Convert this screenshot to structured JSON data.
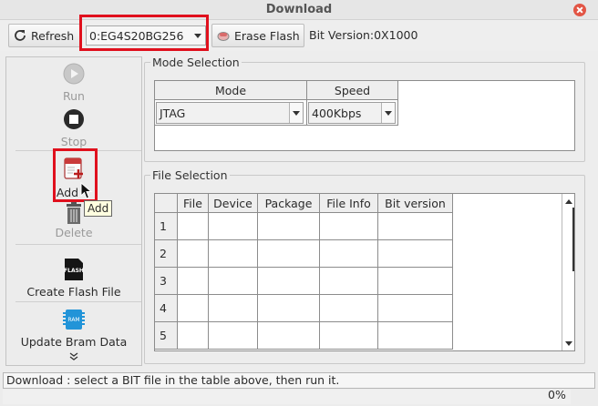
{
  "window": {
    "title": "Download"
  },
  "toolbar": {
    "refresh_label": "Refresh",
    "device_value": "0:EG4S20BG256",
    "erase_label": "Erase Flash",
    "bit_version": "Bit Version:0X1000"
  },
  "left": {
    "run_label": "Run",
    "stop_label": "Stop",
    "add_label": "Add",
    "delete_label": "Delete",
    "flash_icon_text": "FLASH",
    "create_flash_label": "Create Flash File",
    "ram_icon_text": "RAM",
    "update_bram_label": "Update Bram Data"
  },
  "mode_selection": {
    "title": "Mode Selection",
    "headers": [
      "Mode",
      "Speed"
    ],
    "mode_value": "JTAG",
    "speed_value": "400Kbps"
  },
  "file_selection": {
    "title": "File Selection",
    "headers": [
      "File",
      "Device",
      "Package",
      "File Info",
      "Bit version"
    ],
    "rows": [
      "1",
      "2",
      "3",
      "4",
      "5"
    ]
  },
  "tooltip": "Add",
  "status": {
    "message": "Download : select a BIT file in the table above, then run it.",
    "progress_percent": "0%",
    "progress_value": 0
  },
  "colors": {
    "highlight": "#e0101d",
    "close": "#e25545"
  }
}
